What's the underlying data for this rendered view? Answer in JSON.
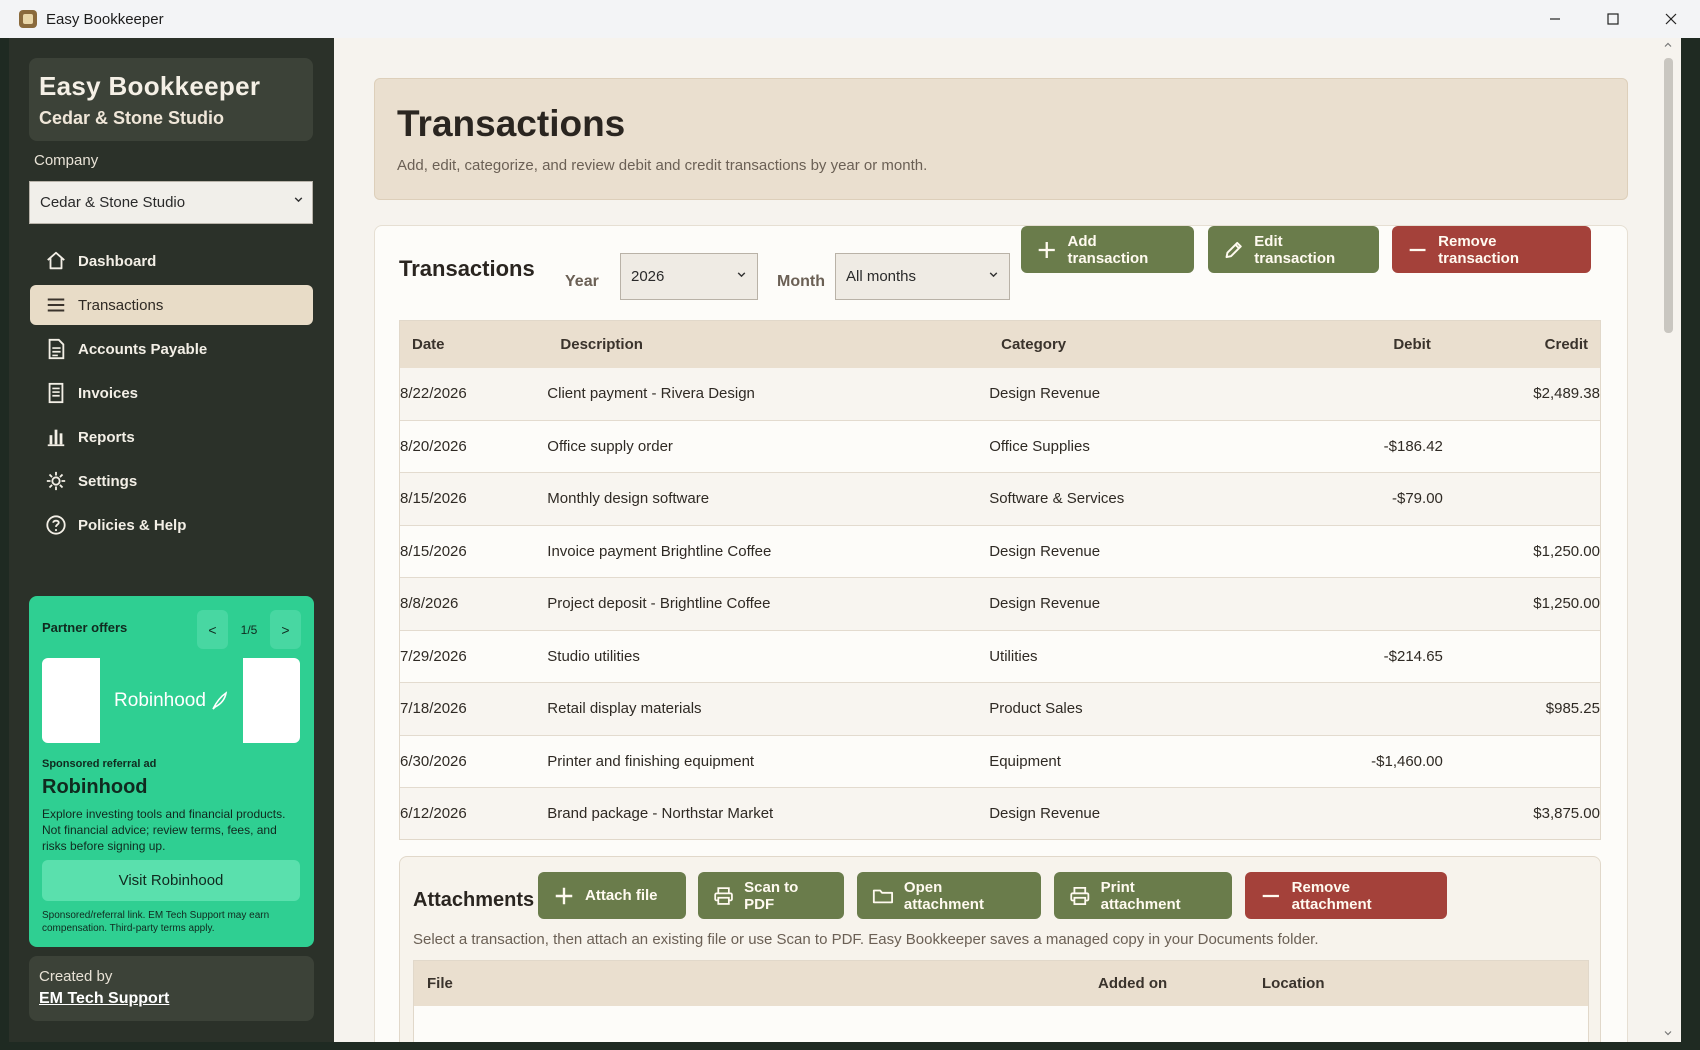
{
  "window": {
    "title": "Easy Bookkeeper",
    "minimize": "—",
    "maximize": "☐",
    "close": "✕"
  },
  "sidebar": {
    "brand_title": "Easy Bookkeeper",
    "brand_subtitle": "Cedar & Stone Studio",
    "company_label": "Company",
    "company_selected": "Cedar & Stone Studio",
    "nav": [
      {
        "label": "Dashboard",
        "icon": "home-icon"
      },
      {
        "label": "Transactions",
        "icon": "list-icon",
        "active": true
      },
      {
        "label": "Accounts Payable",
        "icon": "document-icon"
      },
      {
        "label": "Invoices",
        "icon": "invoice-icon"
      },
      {
        "label": "Reports",
        "icon": "bar-chart-icon"
      },
      {
        "label": "Settings",
        "icon": "gear-icon"
      },
      {
        "label": "Policies & Help",
        "icon": "help-icon"
      }
    ],
    "promo": {
      "heading": "Partner offers",
      "prev": "<",
      "next": ">",
      "counter": "1/5",
      "logo_text": "Robinhood",
      "sponsored": "Sponsored referral ad",
      "name": "Robinhood",
      "description": "Explore investing tools and financial products. Not financial advice; review terms, fees, and risks before signing up.",
      "cta": "Visit Robinhood",
      "fine_print": "Sponsored/referral link. EM Tech Support may earn compensation. Third-party terms apply.",
      "brand_color": "#2fcf92"
    },
    "credit_label": "Created by",
    "credit_link": "EM Tech Support"
  },
  "hero": {
    "title": "Transactions",
    "subtitle": "Add, edit, categorize, and review debit and credit transactions by year or month."
  },
  "transactions": {
    "title": "Transactions",
    "year_label": "Year",
    "year_value": "2026",
    "month_label": "Month",
    "month_value": "All months",
    "add_label": "Add transaction",
    "edit_label": "Edit transaction",
    "remove_label": "Remove transaction",
    "columns": {
      "date": "Date",
      "description": "Description",
      "category": "Category",
      "debit": "Debit",
      "credit": "Credit"
    },
    "rows": [
      {
        "date": "8/22/2026",
        "description": "Client payment - Rivera Design",
        "category": "Design Revenue",
        "debit": "",
        "credit": "$2,489.38"
      },
      {
        "date": "8/20/2026",
        "description": "Office supply order",
        "category": "Office Supplies",
        "debit": "-$186.42",
        "credit": ""
      },
      {
        "date": "8/15/2026",
        "description": "Monthly design software",
        "category": "Software & Services",
        "debit": "-$79.00",
        "credit": ""
      },
      {
        "date": "8/15/2026",
        "description": "Invoice payment Brightline Coffee",
        "category": "Design Revenue",
        "debit": "",
        "credit": "$1,250.00"
      },
      {
        "date": "8/8/2026",
        "description": "Project deposit - Brightline Coffee",
        "category": "Design Revenue",
        "debit": "",
        "credit": "$1,250.00"
      },
      {
        "date": "7/29/2026",
        "description": "Studio utilities",
        "category": "Utilities",
        "debit": "-$214.65",
        "credit": ""
      },
      {
        "date": "7/18/2026",
        "description": "Retail display materials",
        "category": "Product Sales",
        "debit": "",
        "credit": "$985.25"
      },
      {
        "date": "6/30/2026",
        "description": "Printer and finishing equipment",
        "category": "Equipment",
        "debit": "-$1,460.00",
        "credit": ""
      },
      {
        "date": "6/12/2026",
        "description": "Brand package - Northstar Market",
        "category": "Design Revenue",
        "debit": "",
        "credit": "$3,875.00"
      }
    ]
  },
  "attachments": {
    "title": "Attachments",
    "attach_label": "Attach file",
    "scan_label": "Scan to PDF",
    "open_label": "Open attachment",
    "print_label": "Print attachment",
    "remove_label": "Remove attachment",
    "note": "Select a transaction, then attach an existing file or use Scan to PDF. Easy Bookkeeper saves a managed copy in your Documents folder.",
    "columns": {
      "file": "File",
      "added_on": "Added on",
      "location": "Location"
    }
  },
  "colors": {
    "sidebar": "#2b3129",
    "accent_green": "#6a7c4b",
    "danger": "#a4413a",
    "header_tan": "#eadfcf"
  }
}
